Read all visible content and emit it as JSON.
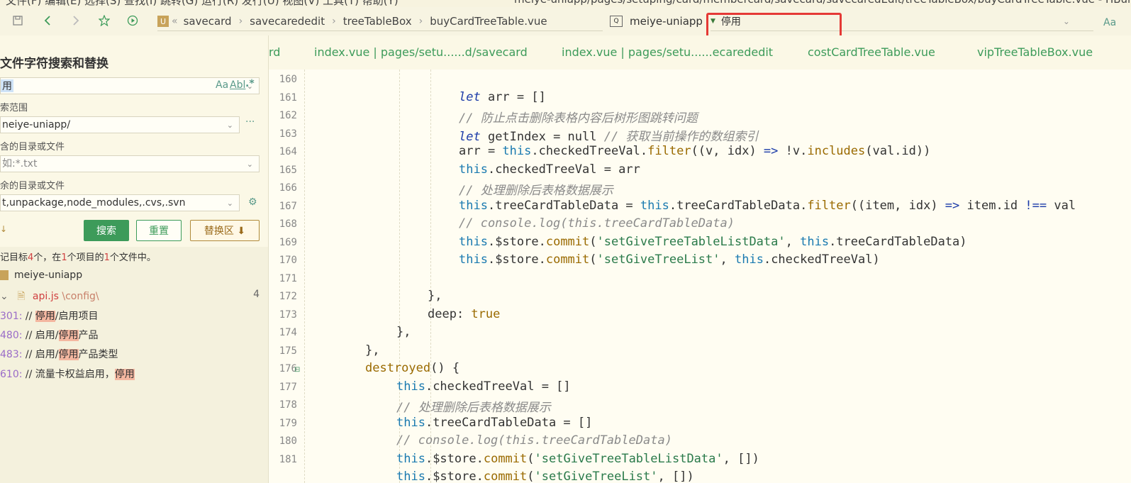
{
  "menu": {
    "text": "文件(F)  编辑(E)  选择(S)  查找(I)  跳转(G)  运行(R)  发行(U)  视图(V)  工具(T)  帮助(Y)",
    "path": "meiye-uniapp/pages/setuping/card/membercard/savecard/savecaredEdit/treeTableBox/buyCardTreeTable.vue - HBuilder X"
  },
  "breadcrumb": {
    "items": [
      "savecard",
      "savecarededit",
      "treeTableBox",
      "buyCardTreeTable.vue"
    ]
  },
  "project_selector": {
    "name": "meiye-uniapp"
  },
  "top_search": {
    "value": "停用",
    "case_label": "Aa"
  },
  "panel": {
    "title": "文件字符搜索和替换",
    "search_value": "用",
    "scope_label": "索范围",
    "scope_value": "neiye-uniapp/",
    "include_label": "含的目录或文件",
    "include_placeholder": "如:*.txt",
    "exclude_label": "余的目录或文件",
    "exclude_value": "t,unpackage,node_modules,.cvs,.svn",
    "search_btn": "搜索",
    "reset_btn": "重置",
    "replace_btn": "替换区 ⬇",
    "options": {
      "case": "Aa",
      "word": "Abl",
      "regex": ".*",
      "more": "···"
    },
    "summary": {
      "prefix": "记目标",
      "n1": "4",
      "mid1": "个，在",
      "n2": "1",
      "mid2": "个项目的",
      "n3": "1",
      "suffix": "个文件中。"
    },
    "project_name": "meiye-uniapp",
    "file_name": "api.js",
    "file_path": " \\config\\",
    "file_count": "4",
    "results": [
      {
        "line": "301:",
        "before": " // ",
        "hit": "停用",
        "after": "/启用项目"
      },
      {
        "line": "480:",
        "before": " // 启用/",
        "hit": "停用",
        "after": "产品"
      },
      {
        "line": "483:",
        "before": " // 启用/",
        "hit": "停用",
        "after": "产品类型"
      },
      {
        "line": "610:",
        "before": " // 流量卡权益启用，",
        "hit": "停用",
        "after": ""
      }
    ]
  },
  "tabs": [
    "rd",
    "index.vue | pages/setu......d/savecard",
    "index.vue | pages/setu......ecarededit",
    "costCardTreeTable.vue",
    "vipTreeTableBox.vue"
  ],
  "line_numbers": [
    "160",
    "161",
    "162",
    "163",
    "164",
    "165",
    "166",
    "167",
    "168",
    "169",
    "170",
    "171",
    "172",
    "173",
    "174",
    "175",
    "176",
    "177",
    "178",
    "179",
    "180",
    "181"
  ],
  "code": {
    "l161": {
      "kw": "let",
      "rest": " arr = []"
    },
    "l162": "// 防止点击删除表格内容后树形图跳转问题",
    "l163": {
      "kw": "let",
      "rest": " getIndex = null ",
      "cm": "// 获取当前操作的数组索引"
    },
    "l164": {
      "this": "this",
      "a": ".checkedTreeVal.",
      "fn": "filter",
      "b": "((v, idx) ",
      "op": "=>",
      "c": " !v.",
      "fn2": "includes",
      "d": "(val.id))",
      "pre": "arr = "
    },
    "l165": {
      "this": "this",
      "rest": ".checkedTreeVal = arr"
    },
    "l166": "// 处理删除后表格数据展示",
    "l167": {
      "this": "this",
      "a": ".treeCardTableData = ",
      "this2": "this",
      "b": ".treeCardTableData.",
      "fn": "filter",
      "c": "((item, idx) ",
      "op": "=>",
      "d": " item.id ",
      "op2": "!==",
      "e": " val"
    },
    "l168": "// console.log(this.treeCardTableData)",
    "l169": {
      "this": "this",
      "a": ".$store.",
      "fn": "commit",
      "b": "(",
      "str": "'setGiveTreeTableListData'",
      "c": ", ",
      "this2": "this",
      "d": ".treeCardTableData)"
    },
    "l170": {
      "this": "this",
      "a": ".$store.",
      "fn": "commit",
      "b": "(",
      "str": "'setGiveTreeList'",
      "c": ", ",
      "this2": "this",
      "d": ".checkedTreeVal)"
    },
    "l172": "},",
    "l173": {
      "a": "deep: ",
      "bool": "true"
    },
    "l174": "},",
    "l175": "},",
    "l176": {
      "fn": "destroyed",
      "rest": "() {"
    },
    "l177": {
      "this": "this",
      "rest": ".checkedTreeVal = []"
    },
    "l178": "// 处理删除后表格数据展示",
    "l179": {
      "this": "this",
      "rest": ".treeCardTableData = []"
    },
    "l180": "// console.log(this.treeCardTableData)",
    "l181": {
      "this": "this",
      "a": ".$store.",
      "fn": "commit",
      "b": "(",
      "str": "'setGiveTreeTableListData'",
      "c": ", [])"
    },
    "l182": {
      "this": "this",
      "a": ".$store.",
      "fn": "commit",
      "b": "(",
      "str": "'setGiveTreeList'",
      "c": ", [])"
    }
  }
}
